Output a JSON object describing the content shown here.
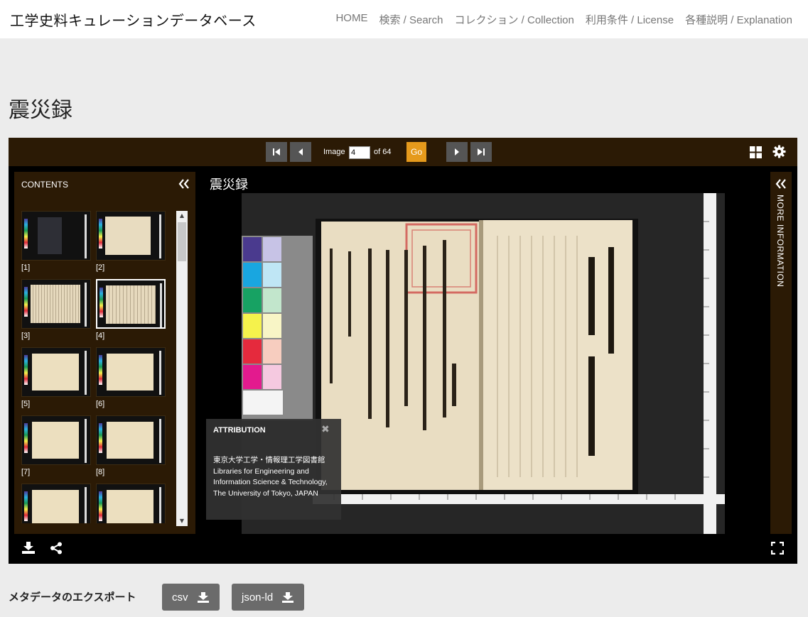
{
  "header": {
    "site_title": "工学史料キュレーションデータベース",
    "nav": [
      "HOME",
      "検索 / Search",
      "コレクション / Collection",
      "利用条件 / License",
      "各種説明 / Explanation"
    ]
  },
  "page": {
    "title": "震災録"
  },
  "viewer": {
    "image_label": "Image",
    "current_image": "4",
    "of_label": "of 64",
    "go_label": "Go",
    "contents_title": "CONTENTS",
    "document_title": "震災録",
    "more_info_label": "MORE INFORMATION",
    "thumbnails": [
      "[1]",
      "[2]",
      "[3]",
      "[4]",
      "[5]",
      "[6]",
      "[7]",
      "[8]",
      "",
      ""
    ],
    "selected_thumbnail": "[4]",
    "attribution": {
      "title": "ATTRIBUTION",
      "text": "東京大学工学・情報理工学図書館 Libraries for Engineering and Information Science & Technology, The University of Tokyo, JAPAN"
    },
    "colors": {
      "bar": "#2b1a05",
      "go": "#e59a1c"
    }
  },
  "export": {
    "label": "メタデータのエクスポート",
    "buttons": [
      "csv",
      "json-ld"
    ]
  }
}
